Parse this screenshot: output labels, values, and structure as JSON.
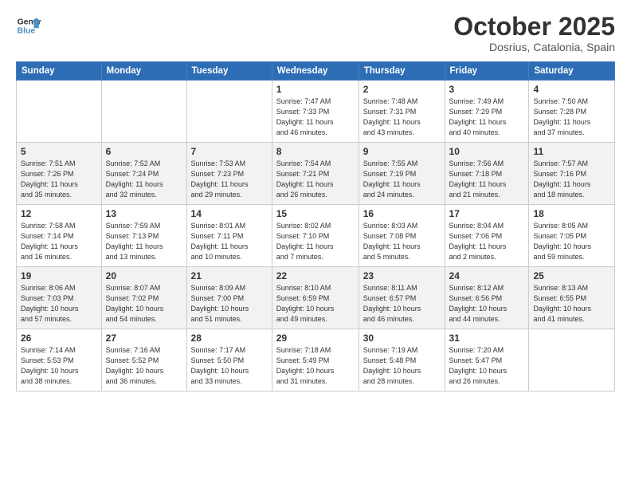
{
  "header": {
    "logo_line1": "General",
    "logo_line2": "Blue",
    "month": "October 2025",
    "location": "Dosrius, Catalonia, Spain"
  },
  "days_of_week": [
    "Sunday",
    "Monday",
    "Tuesday",
    "Wednesday",
    "Thursday",
    "Friday",
    "Saturday"
  ],
  "weeks": [
    [
      {
        "day": "",
        "info": ""
      },
      {
        "day": "",
        "info": ""
      },
      {
        "day": "",
        "info": ""
      },
      {
        "day": "1",
        "info": "Sunrise: 7:47 AM\nSunset: 7:33 PM\nDaylight: 11 hours\nand 46 minutes."
      },
      {
        "day": "2",
        "info": "Sunrise: 7:48 AM\nSunset: 7:31 PM\nDaylight: 11 hours\nand 43 minutes."
      },
      {
        "day": "3",
        "info": "Sunrise: 7:49 AM\nSunset: 7:29 PM\nDaylight: 11 hours\nand 40 minutes."
      },
      {
        "day": "4",
        "info": "Sunrise: 7:50 AM\nSunset: 7:28 PM\nDaylight: 11 hours\nand 37 minutes."
      }
    ],
    [
      {
        "day": "5",
        "info": "Sunrise: 7:51 AM\nSunset: 7:26 PM\nDaylight: 11 hours\nand 35 minutes."
      },
      {
        "day": "6",
        "info": "Sunrise: 7:52 AM\nSunset: 7:24 PM\nDaylight: 11 hours\nand 32 minutes."
      },
      {
        "day": "7",
        "info": "Sunrise: 7:53 AM\nSunset: 7:23 PM\nDaylight: 11 hours\nand 29 minutes."
      },
      {
        "day": "8",
        "info": "Sunrise: 7:54 AM\nSunset: 7:21 PM\nDaylight: 11 hours\nand 26 minutes."
      },
      {
        "day": "9",
        "info": "Sunrise: 7:55 AM\nSunset: 7:19 PM\nDaylight: 11 hours\nand 24 minutes."
      },
      {
        "day": "10",
        "info": "Sunrise: 7:56 AM\nSunset: 7:18 PM\nDaylight: 11 hours\nand 21 minutes."
      },
      {
        "day": "11",
        "info": "Sunrise: 7:57 AM\nSunset: 7:16 PM\nDaylight: 11 hours\nand 18 minutes."
      }
    ],
    [
      {
        "day": "12",
        "info": "Sunrise: 7:58 AM\nSunset: 7:14 PM\nDaylight: 11 hours\nand 16 minutes."
      },
      {
        "day": "13",
        "info": "Sunrise: 7:59 AM\nSunset: 7:13 PM\nDaylight: 11 hours\nand 13 minutes."
      },
      {
        "day": "14",
        "info": "Sunrise: 8:01 AM\nSunset: 7:11 PM\nDaylight: 11 hours\nand 10 minutes."
      },
      {
        "day": "15",
        "info": "Sunrise: 8:02 AM\nSunset: 7:10 PM\nDaylight: 11 hours\nand 7 minutes."
      },
      {
        "day": "16",
        "info": "Sunrise: 8:03 AM\nSunset: 7:08 PM\nDaylight: 11 hours\nand 5 minutes."
      },
      {
        "day": "17",
        "info": "Sunrise: 8:04 AM\nSunset: 7:06 PM\nDaylight: 11 hours\nand 2 minutes."
      },
      {
        "day": "18",
        "info": "Sunrise: 8:05 AM\nSunset: 7:05 PM\nDaylight: 10 hours\nand 59 minutes."
      }
    ],
    [
      {
        "day": "19",
        "info": "Sunrise: 8:06 AM\nSunset: 7:03 PM\nDaylight: 10 hours\nand 57 minutes."
      },
      {
        "day": "20",
        "info": "Sunrise: 8:07 AM\nSunset: 7:02 PM\nDaylight: 10 hours\nand 54 minutes."
      },
      {
        "day": "21",
        "info": "Sunrise: 8:09 AM\nSunset: 7:00 PM\nDaylight: 10 hours\nand 51 minutes."
      },
      {
        "day": "22",
        "info": "Sunrise: 8:10 AM\nSunset: 6:59 PM\nDaylight: 10 hours\nand 49 minutes."
      },
      {
        "day": "23",
        "info": "Sunrise: 8:11 AM\nSunset: 6:57 PM\nDaylight: 10 hours\nand 46 minutes."
      },
      {
        "day": "24",
        "info": "Sunrise: 8:12 AM\nSunset: 6:56 PM\nDaylight: 10 hours\nand 44 minutes."
      },
      {
        "day": "25",
        "info": "Sunrise: 8:13 AM\nSunset: 6:55 PM\nDaylight: 10 hours\nand 41 minutes."
      }
    ],
    [
      {
        "day": "26",
        "info": "Sunrise: 7:14 AM\nSunset: 5:53 PM\nDaylight: 10 hours\nand 38 minutes."
      },
      {
        "day": "27",
        "info": "Sunrise: 7:16 AM\nSunset: 5:52 PM\nDaylight: 10 hours\nand 36 minutes."
      },
      {
        "day": "28",
        "info": "Sunrise: 7:17 AM\nSunset: 5:50 PM\nDaylight: 10 hours\nand 33 minutes."
      },
      {
        "day": "29",
        "info": "Sunrise: 7:18 AM\nSunset: 5:49 PM\nDaylight: 10 hours\nand 31 minutes."
      },
      {
        "day": "30",
        "info": "Sunrise: 7:19 AM\nSunset: 5:48 PM\nDaylight: 10 hours\nand 28 minutes."
      },
      {
        "day": "31",
        "info": "Sunrise: 7:20 AM\nSunset: 5:47 PM\nDaylight: 10 hours\nand 26 minutes."
      },
      {
        "day": "",
        "info": ""
      }
    ]
  ]
}
